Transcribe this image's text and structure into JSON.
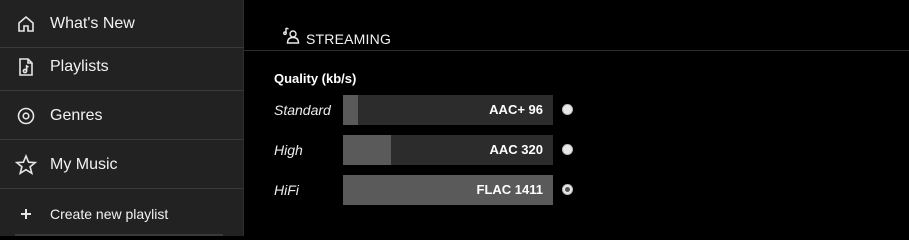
{
  "sidebar": {
    "items": [
      {
        "label": "What's New",
        "icon": "home-icon"
      },
      {
        "label": "Playlists",
        "icon": "playlist-file-icon"
      },
      {
        "label": "Genres",
        "icon": "vinyl-icon"
      },
      {
        "label": "My Music",
        "icon": "star-icon"
      }
    ],
    "create": {
      "label": "Create new playlist",
      "icon": "plus-icon"
    }
  },
  "streaming": {
    "title": "STREAMING",
    "icon": "streaming-user-icon",
    "quality_title": "Quality (kb/s)",
    "options": [
      {
        "label": "Standard",
        "value": "AAC+ 96",
        "level_fraction": 0.07,
        "selected": false
      },
      {
        "label": "High",
        "value": "AAC 320",
        "level_fraction": 0.23,
        "selected": false
      },
      {
        "label": "HiFi",
        "value": "FLAC 1411",
        "level_fraction": 1.0,
        "selected": true
      }
    ]
  },
  "colors": {
    "sidebar_bg": "#222222",
    "main_bg": "#000000",
    "bar_track": "#2c2c2c",
    "bar_fill": "#5a5a5a"
  }
}
